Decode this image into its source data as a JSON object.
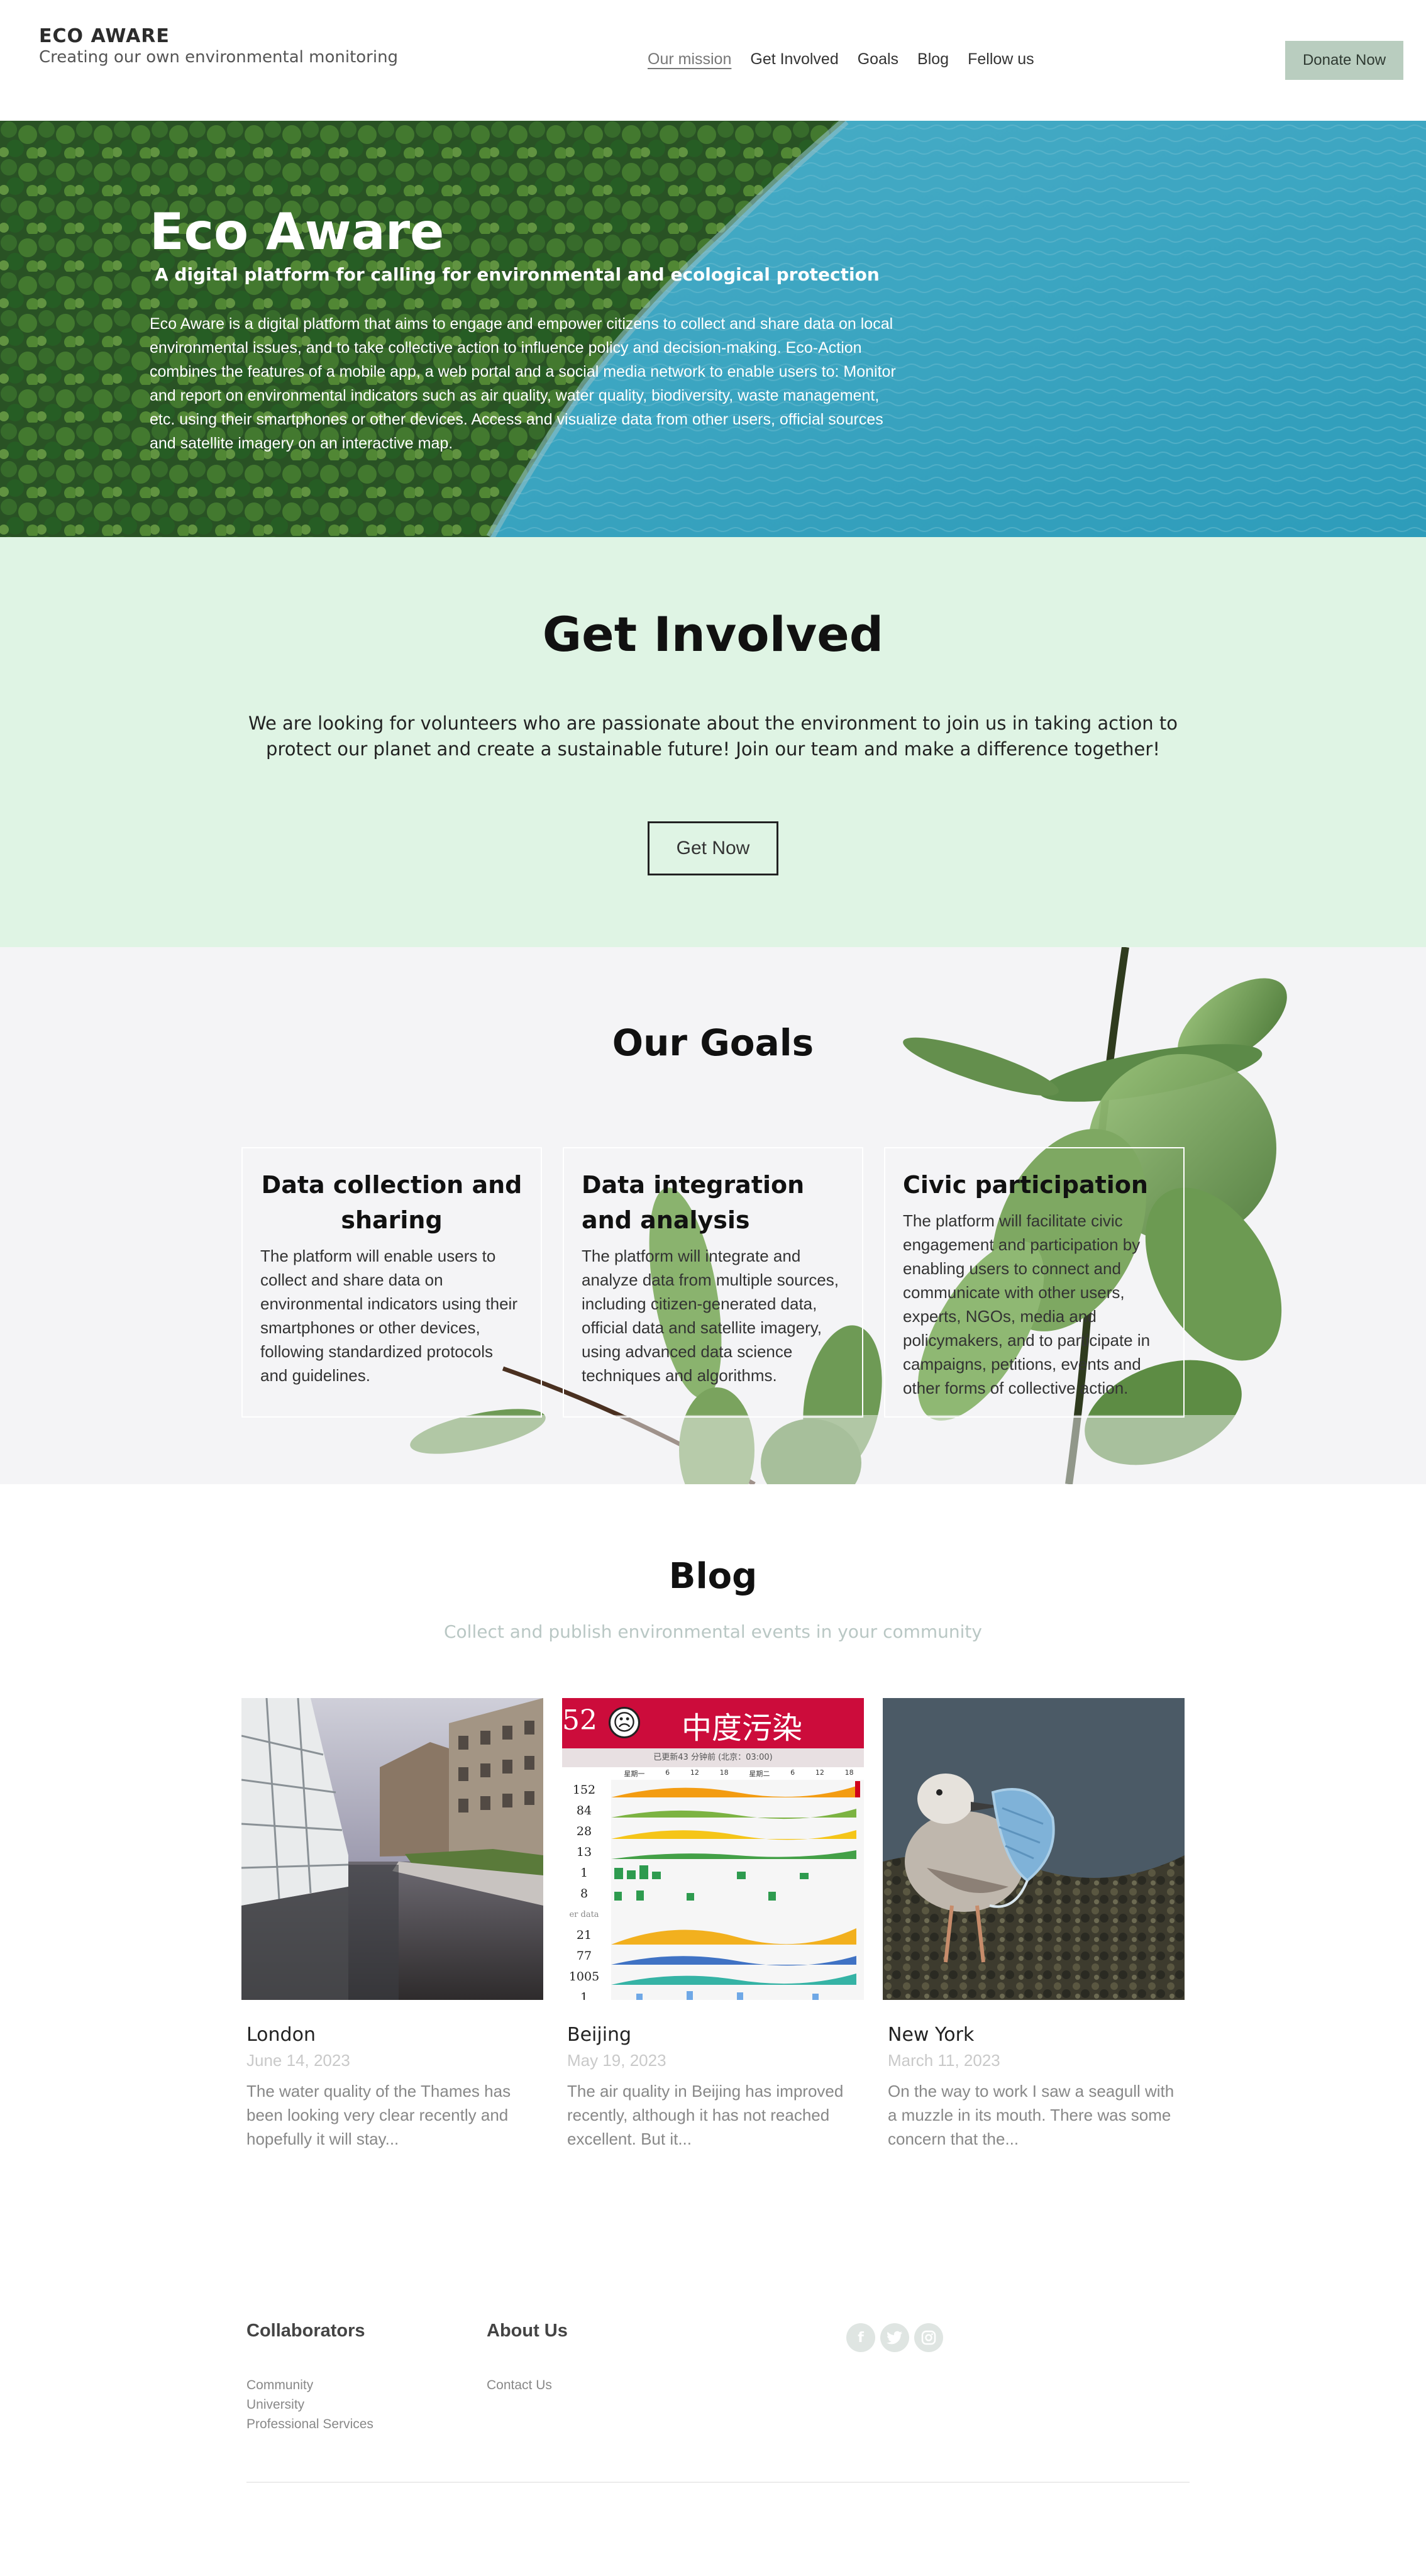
{
  "header": {
    "brand": "ECO AWARE",
    "tagline": "Creating our own environmental monitoring",
    "nav": [
      "Our mission",
      "Get Involved",
      "Goals",
      "Blog",
      "Fellow us"
    ],
    "donate_label": "Donate Now"
  },
  "hero": {
    "title": "Eco Aware",
    "tagline": "A digital platform for calling for environmental and ecological protection",
    "description": "Eco Aware is a digital platform that aims to engage and empower citizens to collect and share data on local environmental issues, and to take collective action to influence policy and decision-making. Eco-Action combines the features of a mobile app, a web portal and a social media network to enable users to: Monitor and report on environmental indicators such as air quality, water quality, biodiversity, waste management, etc. using their smartphones or other devices. Access and visualize data from other users, official sources and satellite imagery on an interactive map."
  },
  "involved": {
    "title": "Get Involved",
    "text": "We are looking for volunteers who are passionate about the environment to join us in taking action to protect our planet and create a sustainable future! Join our team and make a difference together!",
    "button": "Get Now"
  },
  "goals": {
    "title": "Our Goals",
    "cards": [
      {
        "title": "Data collection and sharing",
        "text": "The platform will enable users to collect and share data on environmental indicators using their smartphones or other devices, following standardized protocols and guidelines."
      },
      {
        "title": "Data integration and analysis",
        "text": "The platform will integrate and analyze data from multiple sources, including citizen-generated data, official data and satellite imagery, using advanced data science techniques and algorithms."
      },
      {
        "title": "Civic participation",
        "text": "The platform will facilitate civic engagement and participation by enabling users to connect and communicate with other users, experts, NGOs, media and policymakers, and to participate in campaigns, petitions, events and other forms of collective action."
      }
    ]
  },
  "blog": {
    "title": "Blog",
    "subtitle": "Collect and publish environmental events in your community",
    "posts": [
      {
        "city": "London",
        "date": "June 14, 2023",
        "excerpt": "The water quality of the Thames has been looking very clear recently and hopefully it will stay..."
      },
      {
        "city": "Beijing",
        "date": "May 19, 2023",
        "excerpt": "The air quality in Beijing has improved recently, although it has not reached excellent. But it..."
      },
      {
        "city": "New York",
        "date": "March 11, 2023",
        "excerpt": "On the way to work I saw a seagull with a muzzle in its mouth. There was some concern that the..."
      }
    ],
    "beijing_image": {
      "aqi": "52",
      "banner": "中度污染",
      "subline": "已更新43 分钟前 (北京：03:00)",
      "day_labels": [
        "星期一",
        "6",
        "12",
        "18",
        "星期二",
        "6",
        "12",
        "18"
      ],
      "row_values": [
        "152",
        "84",
        "28",
        "13",
        "1",
        "8",
        "21",
        "77",
        "1005",
        "1"
      ],
      "other_label": "er data"
    }
  },
  "footer": {
    "collaborators_title": "Collaborators",
    "collaborators": [
      "Community",
      "University",
      "Professional Services"
    ],
    "about_title": "About Us",
    "about_links": [
      "Contact Us"
    ],
    "socials": [
      "facebook-icon",
      "twitter-icon",
      "instagram-icon"
    ]
  },
  "colors": {
    "accent_green_bg": "#dff4e4",
    "donate_button": "#b9cdbf",
    "goals_bg": "#f4f4f6",
    "lake": "#4cc0df",
    "banner_red": "#cc0c3b"
  }
}
